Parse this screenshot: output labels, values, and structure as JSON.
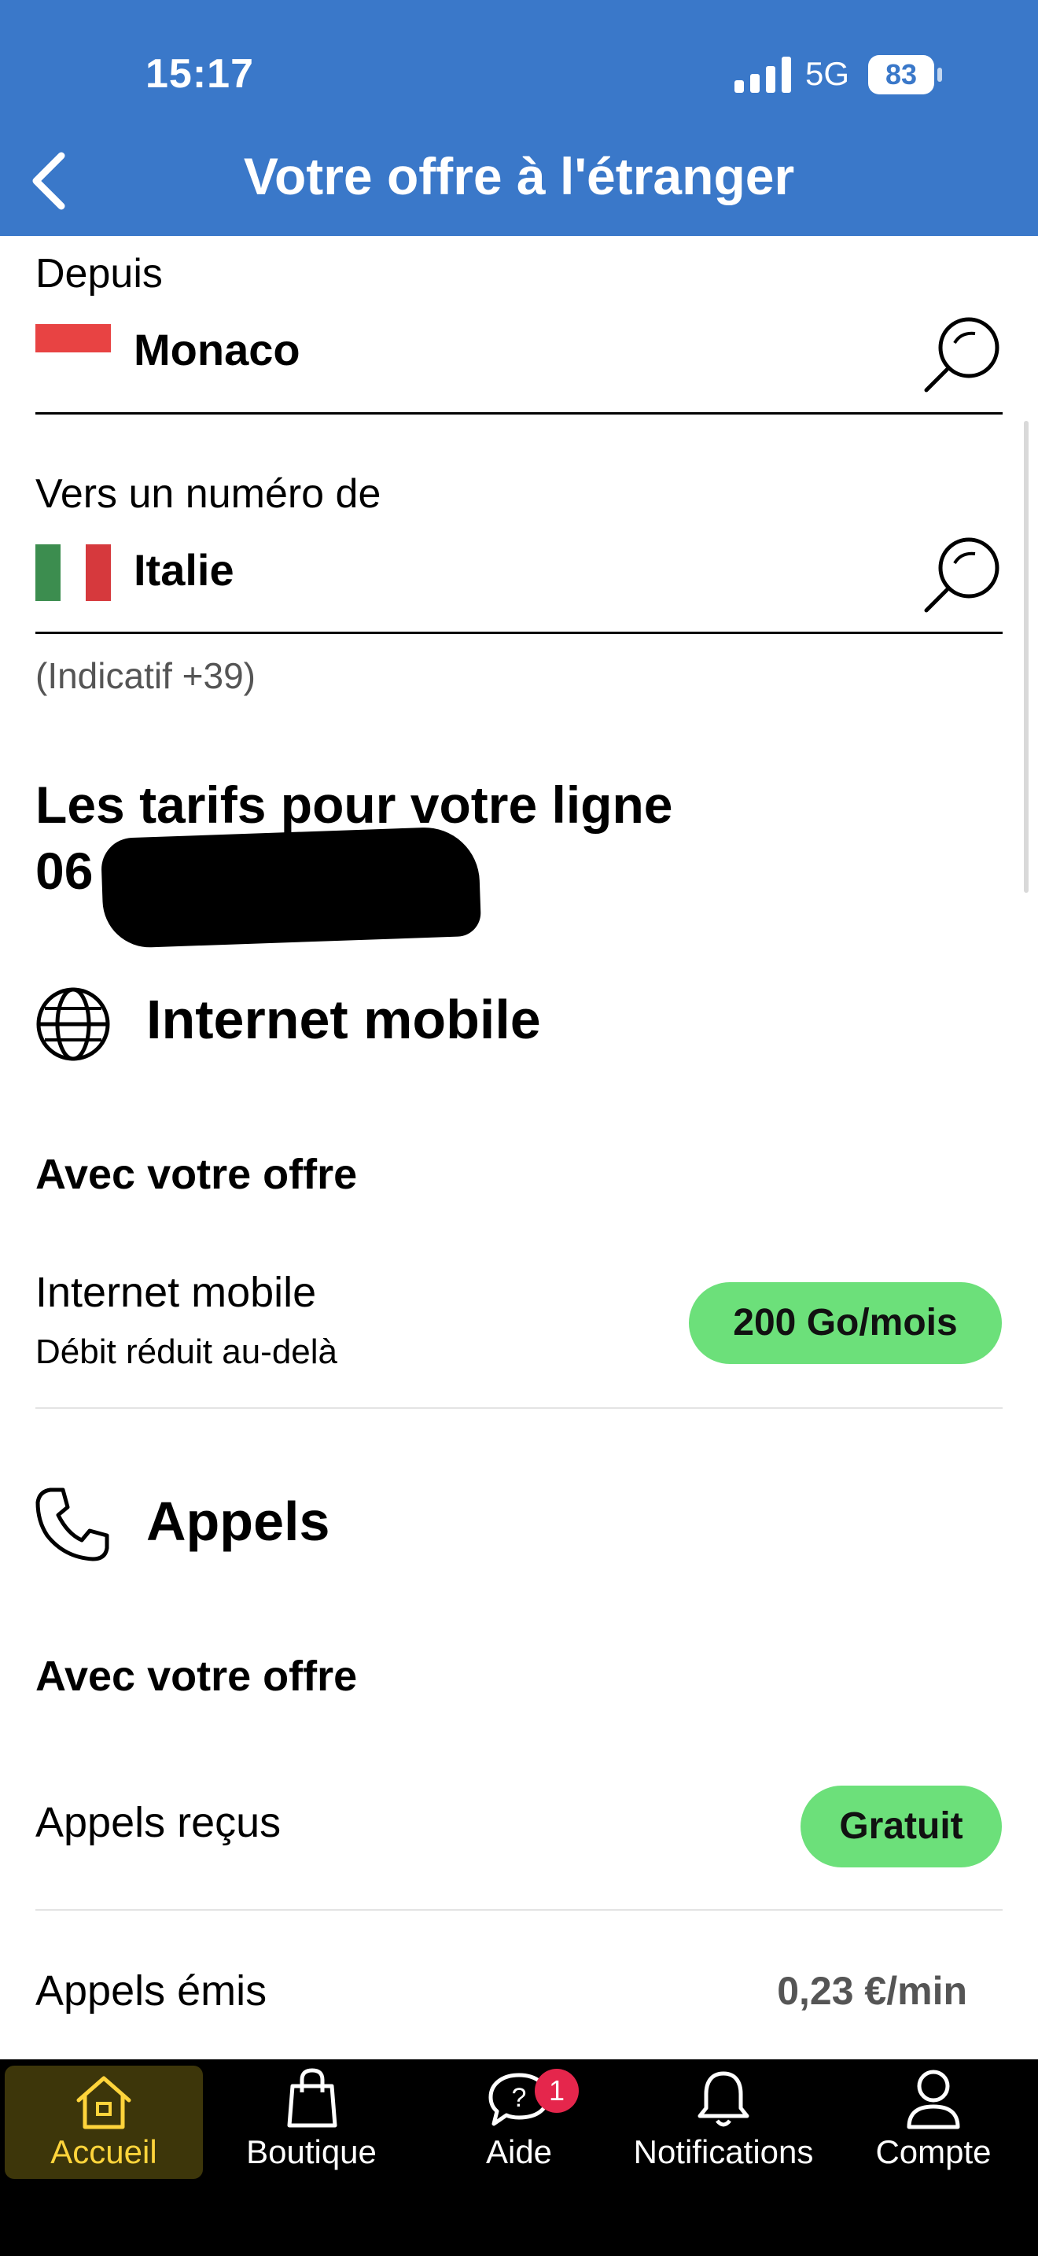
{
  "status_bar": {
    "time": "15:17",
    "network": "5G",
    "battery": "83"
  },
  "header": {
    "title": "Votre offre à l'étranger"
  },
  "from": {
    "label": "Depuis",
    "country": "Monaco"
  },
  "to": {
    "label": "Vers un numéro de",
    "country": "Italie",
    "hint": "(Indicatif +39)"
  },
  "rates": {
    "heading_line1": "Les tarifs pour votre ligne",
    "number_prefix": "06"
  },
  "internet": {
    "title": "Internet mobile",
    "subheading": "Avec votre offre",
    "row_title": "Internet mobile",
    "row_sub": "Débit réduit au-delà",
    "allowance": "200 Go/mois"
  },
  "calls": {
    "title": "Appels",
    "subheading": "Avec votre offre",
    "received_label": "Appels reçus",
    "received_value": "Gratuit",
    "emitted_label": "Appels émis",
    "emitted_value": "0,23 €/min"
  },
  "tabs": [
    {
      "label": "Accueil",
      "icon": "home-icon"
    },
    {
      "label": "Boutique",
      "icon": "shopping-bag-icon"
    },
    {
      "label": "Aide",
      "icon": "help-chat-icon",
      "badge": "1"
    },
    {
      "label": "Notifications",
      "icon": "bell-icon"
    },
    {
      "label": "Compte",
      "icon": "user-icon"
    }
  ],
  "colors": {
    "header_blue": "#3a78c9",
    "pill_green": "#6ce07a",
    "active_tab": "#ffd43b",
    "badge_red": "#e5264c"
  }
}
